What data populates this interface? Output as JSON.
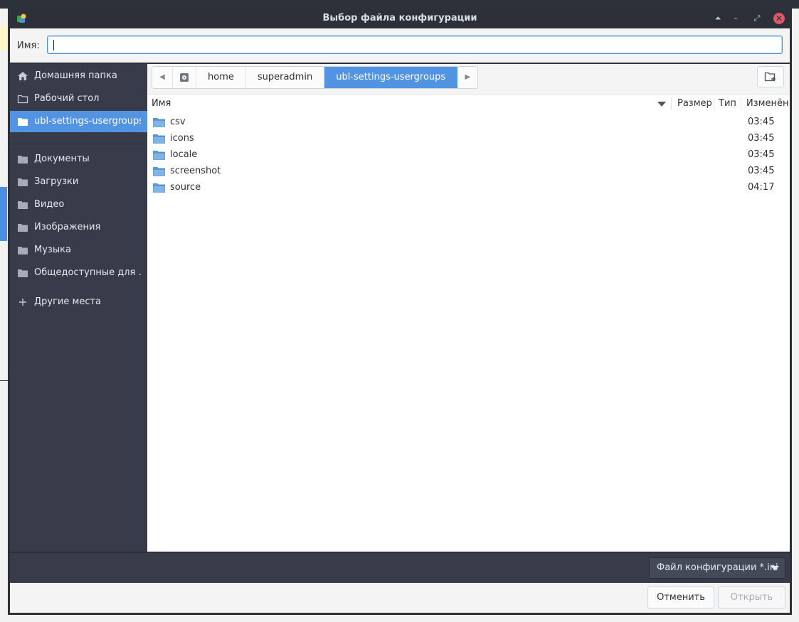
{
  "window": {
    "title": "Выбор файла конфигурации",
    "buttons": {
      "roll_up": "⏶",
      "minimize": "–",
      "maximize": "⤢",
      "close": "✕"
    }
  },
  "name_field": {
    "label": "Имя:",
    "value": ""
  },
  "sidebar": {
    "items": [
      {
        "label": "Домашняя папка",
        "icon": "home-icon",
        "active": false
      },
      {
        "label": "Рабочий стол",
        "icon": "folder-icon",
        "active": false
      },
      {
        "label": "ubl-settings-usergroups",
        "icon": "folder-icon",
        "active": true
      },
      {
        "label": "Документы",
        "icon": "folder-icon",
        "active": false
      },
      {
        "label": "Загрузки",
        "icon": "folder-icon",
        "active": false
      },
      {
        "label": "Видео",
        "icon": "folder-icon",
        "active": false
      },
      {
        "label": "Изображения",
        "icon": "folder-icon",
        "active": false
      },
      {
        "label": "Музыка",
        "icon": "folder-icon",
        "active": false
      },
      {
        "label": "Общедоступные для …",
        "icon": "folder-icon",
        "active": false
      },
      {
        "label": "Другие места",
        "icon": "plus-icon",
        "active": false
      }
    ]
  },
  "pathbar": {
    "crumbs": [
      "home",
      "superadmin",
      "ubl-settings-usergroups"
    ],
    "active": "ubl-settings-usergroups"
  },
  "columns": {
    "name": "Имя",
    "size": "Размер",
    "type": "Тип",
    "modified": "Изменён"
  },
  "files": [
    {
      "name": "csv",
      "modified": "03:45"
    },
    {
      "name": "icons",
      "modified": "03:45"
    },
    {
      "name": "locale",
      "modified": "03:45"
    },
    {
      "name": "screenshot",
      "modified": "03:45"
    },
    {
      "name": "source",
      "modified": "04:17"
    }
  ],
  "filter": {
    "label": "Файл конфигурации *.ini"
  },
  "actions": {
    "cancel": "Отменить",
    "open": "Открыть"
  },
  "colors": {
    "accent": "#5294e2",
    "sidebar_bg": "#383c4a",
    "titlebar_bg": "#2d3038",
    "close": "#e0576a"
  }
}
